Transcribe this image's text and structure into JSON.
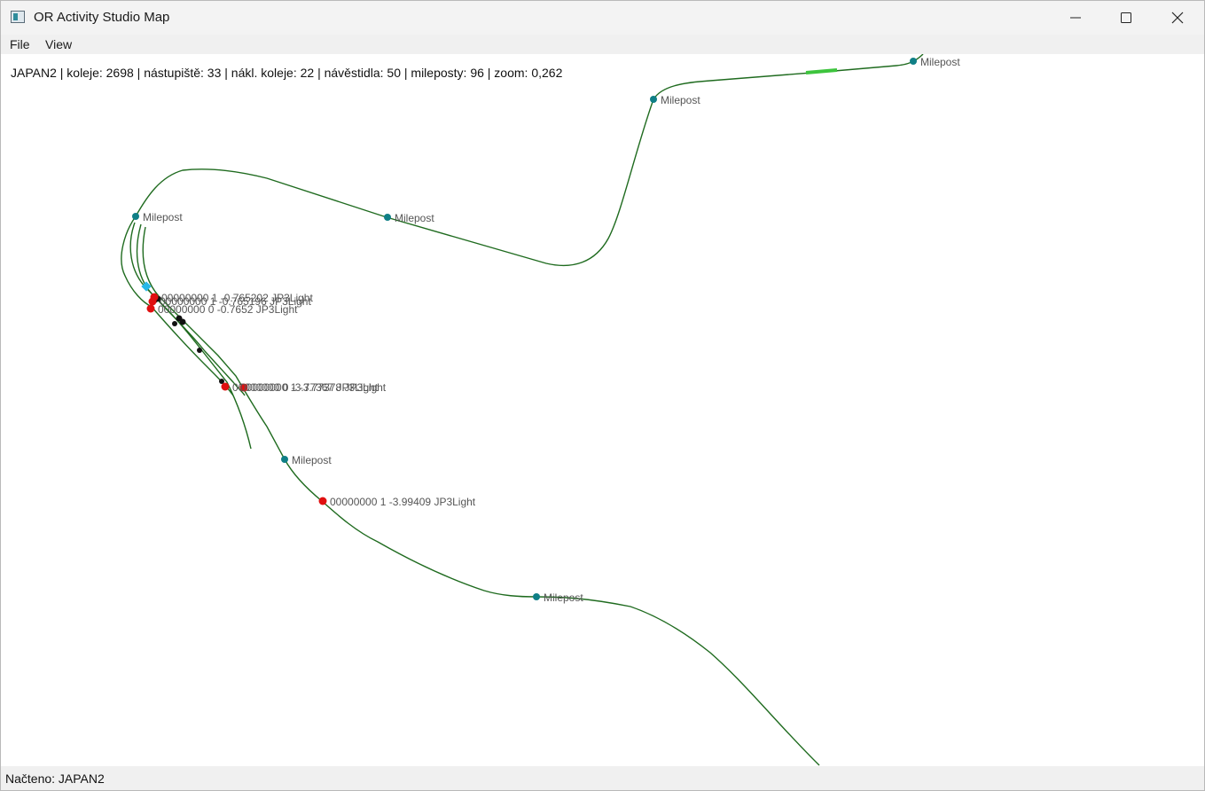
{
  "window": {
    "title": "OR Activity Studio Map",
    "controls": {
      "minimize_icon": "minimize-icon",
      "maximize_icon": "maximize-icon",
      "close_icon": "close-icon"
    }
  },
  "menu": {
    "items": [
      {
        "label": "File"
      },
      {
        "label": "View"
      }
    ]
  },
  "info": {
    "text": "JAPAN2 | koleje: 2698 | nástupiště: 33 | nákl. koleje: 22 | návěstidla: 50 | mileposty: 96 | zoom: 0,262"
  },
  "map": {
    "colors": {
      "track": "#1f6b1f",
      "milepost": "#0f7f86",
      "signal": "#e01010",
      "switch": "#111111",
      "platform": "#3dc43d",
      "selection": "#27b8e8"
    },
    "mileposts": [
      {
        "label": "Milepost"
      },
      {
        "label": "Milepost"
      },
      {
        "label": "Milepost"
      },
      {
        "label": "Milepost"
      },
      {
        "label": "Milepost"
      },
      {
        "label": "Milepost"
      }
    ],
    "signals": [
      {
        "label": "00000000 1 -0.765202 JP3Light"
      },
      {
        "label": "00000000 1 -0.765196 JP3Light"
      },
      {
        "label": "00000000 0 -0.7652 JP3Light"
      },
      {
        "label": "00000000 0 -3.77367 JP3Light"
      },
      {
        "label": "00000000 1 -3.77378 JP3Light"
      },
      {
        "label": "00000000 1 -3.99409 JP3Light"
      }
    ]
  },
  "status": {
    "text": "Načteno: JAPAN2"
  }
}
